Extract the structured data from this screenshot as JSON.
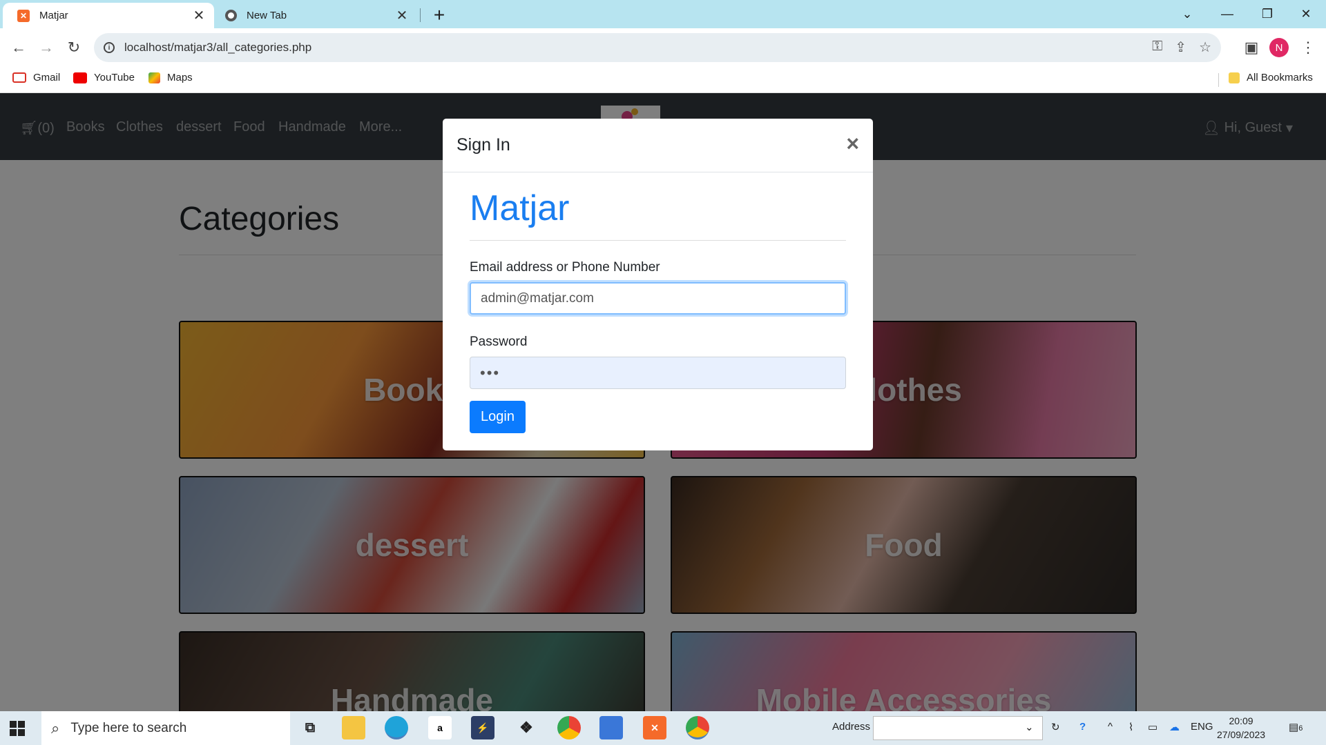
{
  "browser": {
    "tabs": [
      {
        "title": "Matjar",
        "active": true
      },
      {
        "title": "New Tab",
        "active": false
      }
    ],
    "url": "localhost/matjar3/all_categories.php",
    "profile_initial": "N",
    "bookmarks": [
      "Gmail",
      "YouTube",
      "Maps"
    ],
    "all_bookmarks": "All Bookmarks"
  },
  "navbar": {
    "cart": "(0)",
    "links": [
      "Books",
      "Clothes",
      "dessert",
      "Food",
      "Handmade",
      "More..."
    ],
    "user": "Hi, Guest"
  },
  "page": {
    "title": "Categories",
    "categories": [
      "Books",
      "Clothes",
      "dessert",
      "Food",
      "Handmade",
      "Mobile Accessories"
    ]
  },
  "modal": {
    "title": "Sign In",
    "close": "×",
    "brand": "Matjar",
    "email_label": "Email address or Phone Number",
    "email_value": "admin@matjar.com",
    "password_label": "Password",
    "password_value": "•••",
    "login_label": "Login"
  },
  "taskbar": {
    "search_placeholder": "Type here to search",
    "address_label": "Address",
    "language": "ENG",
    "time": "20:09",
    "date": "27/09/2023",
    "notifications": "6"
  },
  "colors": {
    "accent": "#007bff",
    "navbar": "#343a40",
    "tabbar": "#b7e4f0"
  }
}
